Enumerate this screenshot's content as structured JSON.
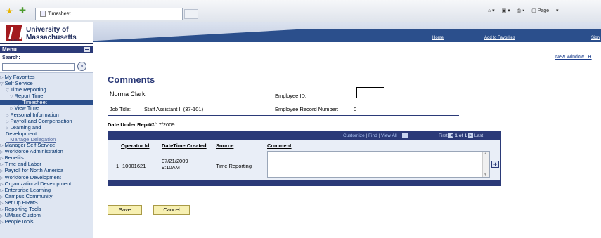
{
  "browser": {
    "tab_title": "Timesheet",
    "tools": [
      "Page"
    ]
  },
  "logo": {
    "line1": "University of",
    "line2": "Massachusetts",
    "mark_text": "UMASS"
  },
  "nav": {
    "menu_title": "Menu",
    "search_label": "Search:",
    "search_value": "",
    "search_go": "»",
    "items": [
      {
        "label": "My Favorites",
        "level": 0,
        "arrow": "▷"
      },
      {
        "label": "Self Service",
        "level": 0,
        "arrow": "▽"
      },
      {
        "label": "Time Reporting",
        "level": 1,
        "arrow": "▽"
      },
      {
        "label": "Report Time",
        "level": 2,
        "arrow": "▽"
      },
      {
        "label": "– Timesheet",
        "level": 3,
        "selected": true
      },
      {
        "label": "View Time",
        "level": 2,
        "arrow": "▷"
      },
      {
        "label": "Personal Information",
        "level": 1,
        "arrow": "▷"
      },
      {
        "label": "Payroll and Compensation",
        "level": 1,
        "arrow": "▷"
      },
      {
        "label": "Learning and",
        "level": 1,
        "arrow": "▷"
      },
      {
        "label": "Development",
        "level": 1,
        "arrow": ""
      },
      {
        "label": "– Manage Delegation",
        "level": 1,
        "sub": true
      },
      {
        "label": "Manager Self Service",
        "level": 0,
        "arrow": "▷"
      },
      {
        "label": "Workforce Administration",
        "level": 0,
        "arrow": "▷"
      },
      {
        "label": "Benefits",
        "level": 0,
        "arrow": "▷"
      },
      {
        "label": "Time and Labor",
        "level": 0,
        "arrow": "▷"
      },
      {
        "label": "Payroll for North America",
        "level": 0,
        "arrow": "▷"
      },
      {
        "label": "Workforce Development",
        "level": 0,
        "arrow": "▷"
      },
      {
        "label": "Organizational Development",
        "level": 0,
        "arrow": "▷"
      },
      {
        "label": "Enterprise Learning",
        "level": 0,
        "arrow": "▷"
      },
      {
        "label": "Campus Community",
        "level": 0,
        "arrow": "▷"
      },
      {
        "label": "Set Up HRMS",
        "level": 0,
        "arrow": "▷"
      },
      {
        "label": "Reporting Tools",
        "level": 0,
        "arrow": "▷"
      },
      {
        "label": "UMass Custom",
        "level": 0,
        "arrow": "▷"
      },
      {
        "label": "PeopleTools",
        "level": 0,
        "arrow": "▷"
      }
    ]
  },
  "header": {
    "links": {
      "home": "Home",
      "favorites": "Add to Favorites",
      "signout": "Sign"
    },
    "new_window": "New Window | H"
  },
  "main": {
    "title": "Comments",
    "employee_name": "Norma Clark",
    "employee_id_label": "Employee ID:",
    "employee_id_value": "",
    "job_title_label": "Job Title:",
    "job_title_value": "Staff Assistant II (37-101)",
    "record_label": "Employee Record Number:",
    "record_value": "0",
    "date_label": "Date Under Report:",
    "date_value": "07/17/2009"
  },
  "grid": {
    "customize": "Customize",
    "find": "Find",
    "view_all": "View All",
    "sep": "|",
    "first": "First",
    "page_info": "1 of 1",
    "last": "Last",
    "columns": {
      "operator": "Operator Id",
      "datetime": "DateTime Created",
      "source": "Source",
      "comment": "Comment"
    },
    "row": {
      "index": "1",
      "operator": "10001621",
      "date": "07/21/2009",
      "time": "9:10AM",
      "source": "Time Reporting",
      "comment": ""
    },
    "add_row": "+"
  },
  "buttons": {
    "save": "Save",
    "cancel": "Cancel"
  }
}
